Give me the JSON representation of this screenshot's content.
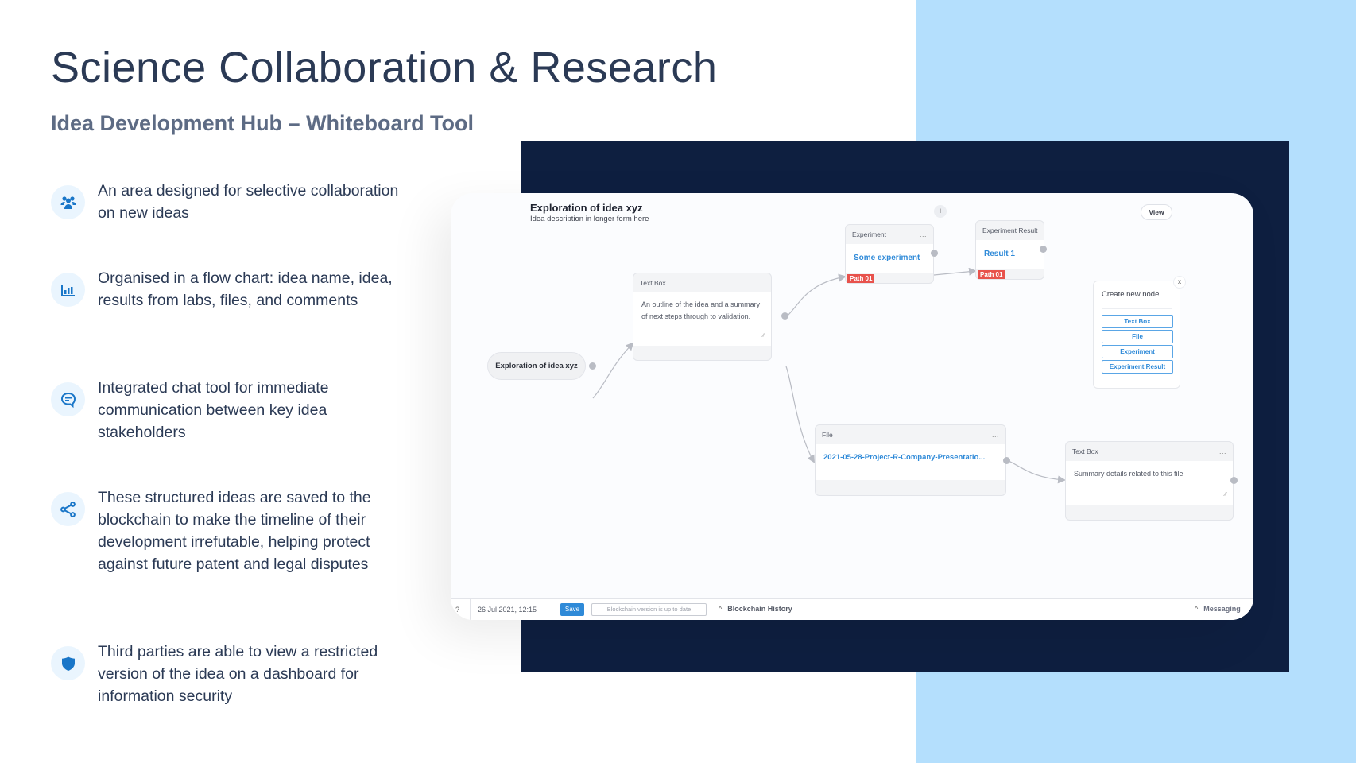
{
  "slide": {
    "title": "Science Collaboration & Research",
    "subtitle": "Idea Development Hub – Whiteboard Tool",
    "colors": {
      "accent": "#1976c8",
      "navy": "#0e1f40",
      "light_blue": "#b4dffd",
      "icon_bg": "#eaf5fe"
    }
  },
  "features": [
    {
      "icon": "users-icon",
      "text": "An area designed for selective collaboration on new ideas"
    },
    {
      "icon": "bar-chart-icon",
      "text": "Organised in a flow chart: idea name, idea, results from labs, files, and comments"
    },
    {
      "icon": "chat-icon",
      "text": "Integrated chat tool for immediate communication between key idea stakeholders"
    },
    {
      "icon": "share-icon",
      "text": "These structured ideas are saved to the blockchain to make the timeline of their development irrefutable, helping protect against future patent and legal disputes"
    },
    {
      "icon": "shield-icon",
      "text": "Third parties are able to view a restricted version of the idea on a dashboard for information security"
    }
  ],
  "app": {
    "idea_title": "Exploration of idea xyz",
    "idea_description": "Idea description in longer form here",
    "add_label": "+",
    "view_label": "View",
    "root_node": "Exploration of idea xyz",
    "nodes": {
      "textbox1": {
        "type": "Text Box",
        "menu": "...",
        "content": "An outline of the idea and a summary of next steps through to validation."
      },
      "experiment": {
        "type": "Experiment",
        "menu": "...",
        "content": "Some experiment",
        "badge": "Path 01"
      },
      "result": {
        "type": "Experiment Result",
        "content": "Result 1",
        "badge": "Path 01"
      },
      "file": {
        "type": "File",
        "menu": "...",
        "content": "2021-05-28-Project-R-Company-Presentatio..."
      },
      "textbox2": {
        "type": "Text Box",
        "menu": "...",
        "content": "Summary details related to this file"
      }
    },
    "create_node": {
      "title": "Create new node",
      "close": "x",
      "options": [
        "Text Box",
        "File",
        "Experiment",
        "Experiment Result"
      ]
    },
    "bottom_bar": {
      "help": "?",
      "date": "26 Jul 2021, 12:15",
      "save": "Save",
      "status": "Blockchain version is up to date",
      "blockchain_history": "Blockchain History",
      "messaging": "Messaging"
    }
  }
}
